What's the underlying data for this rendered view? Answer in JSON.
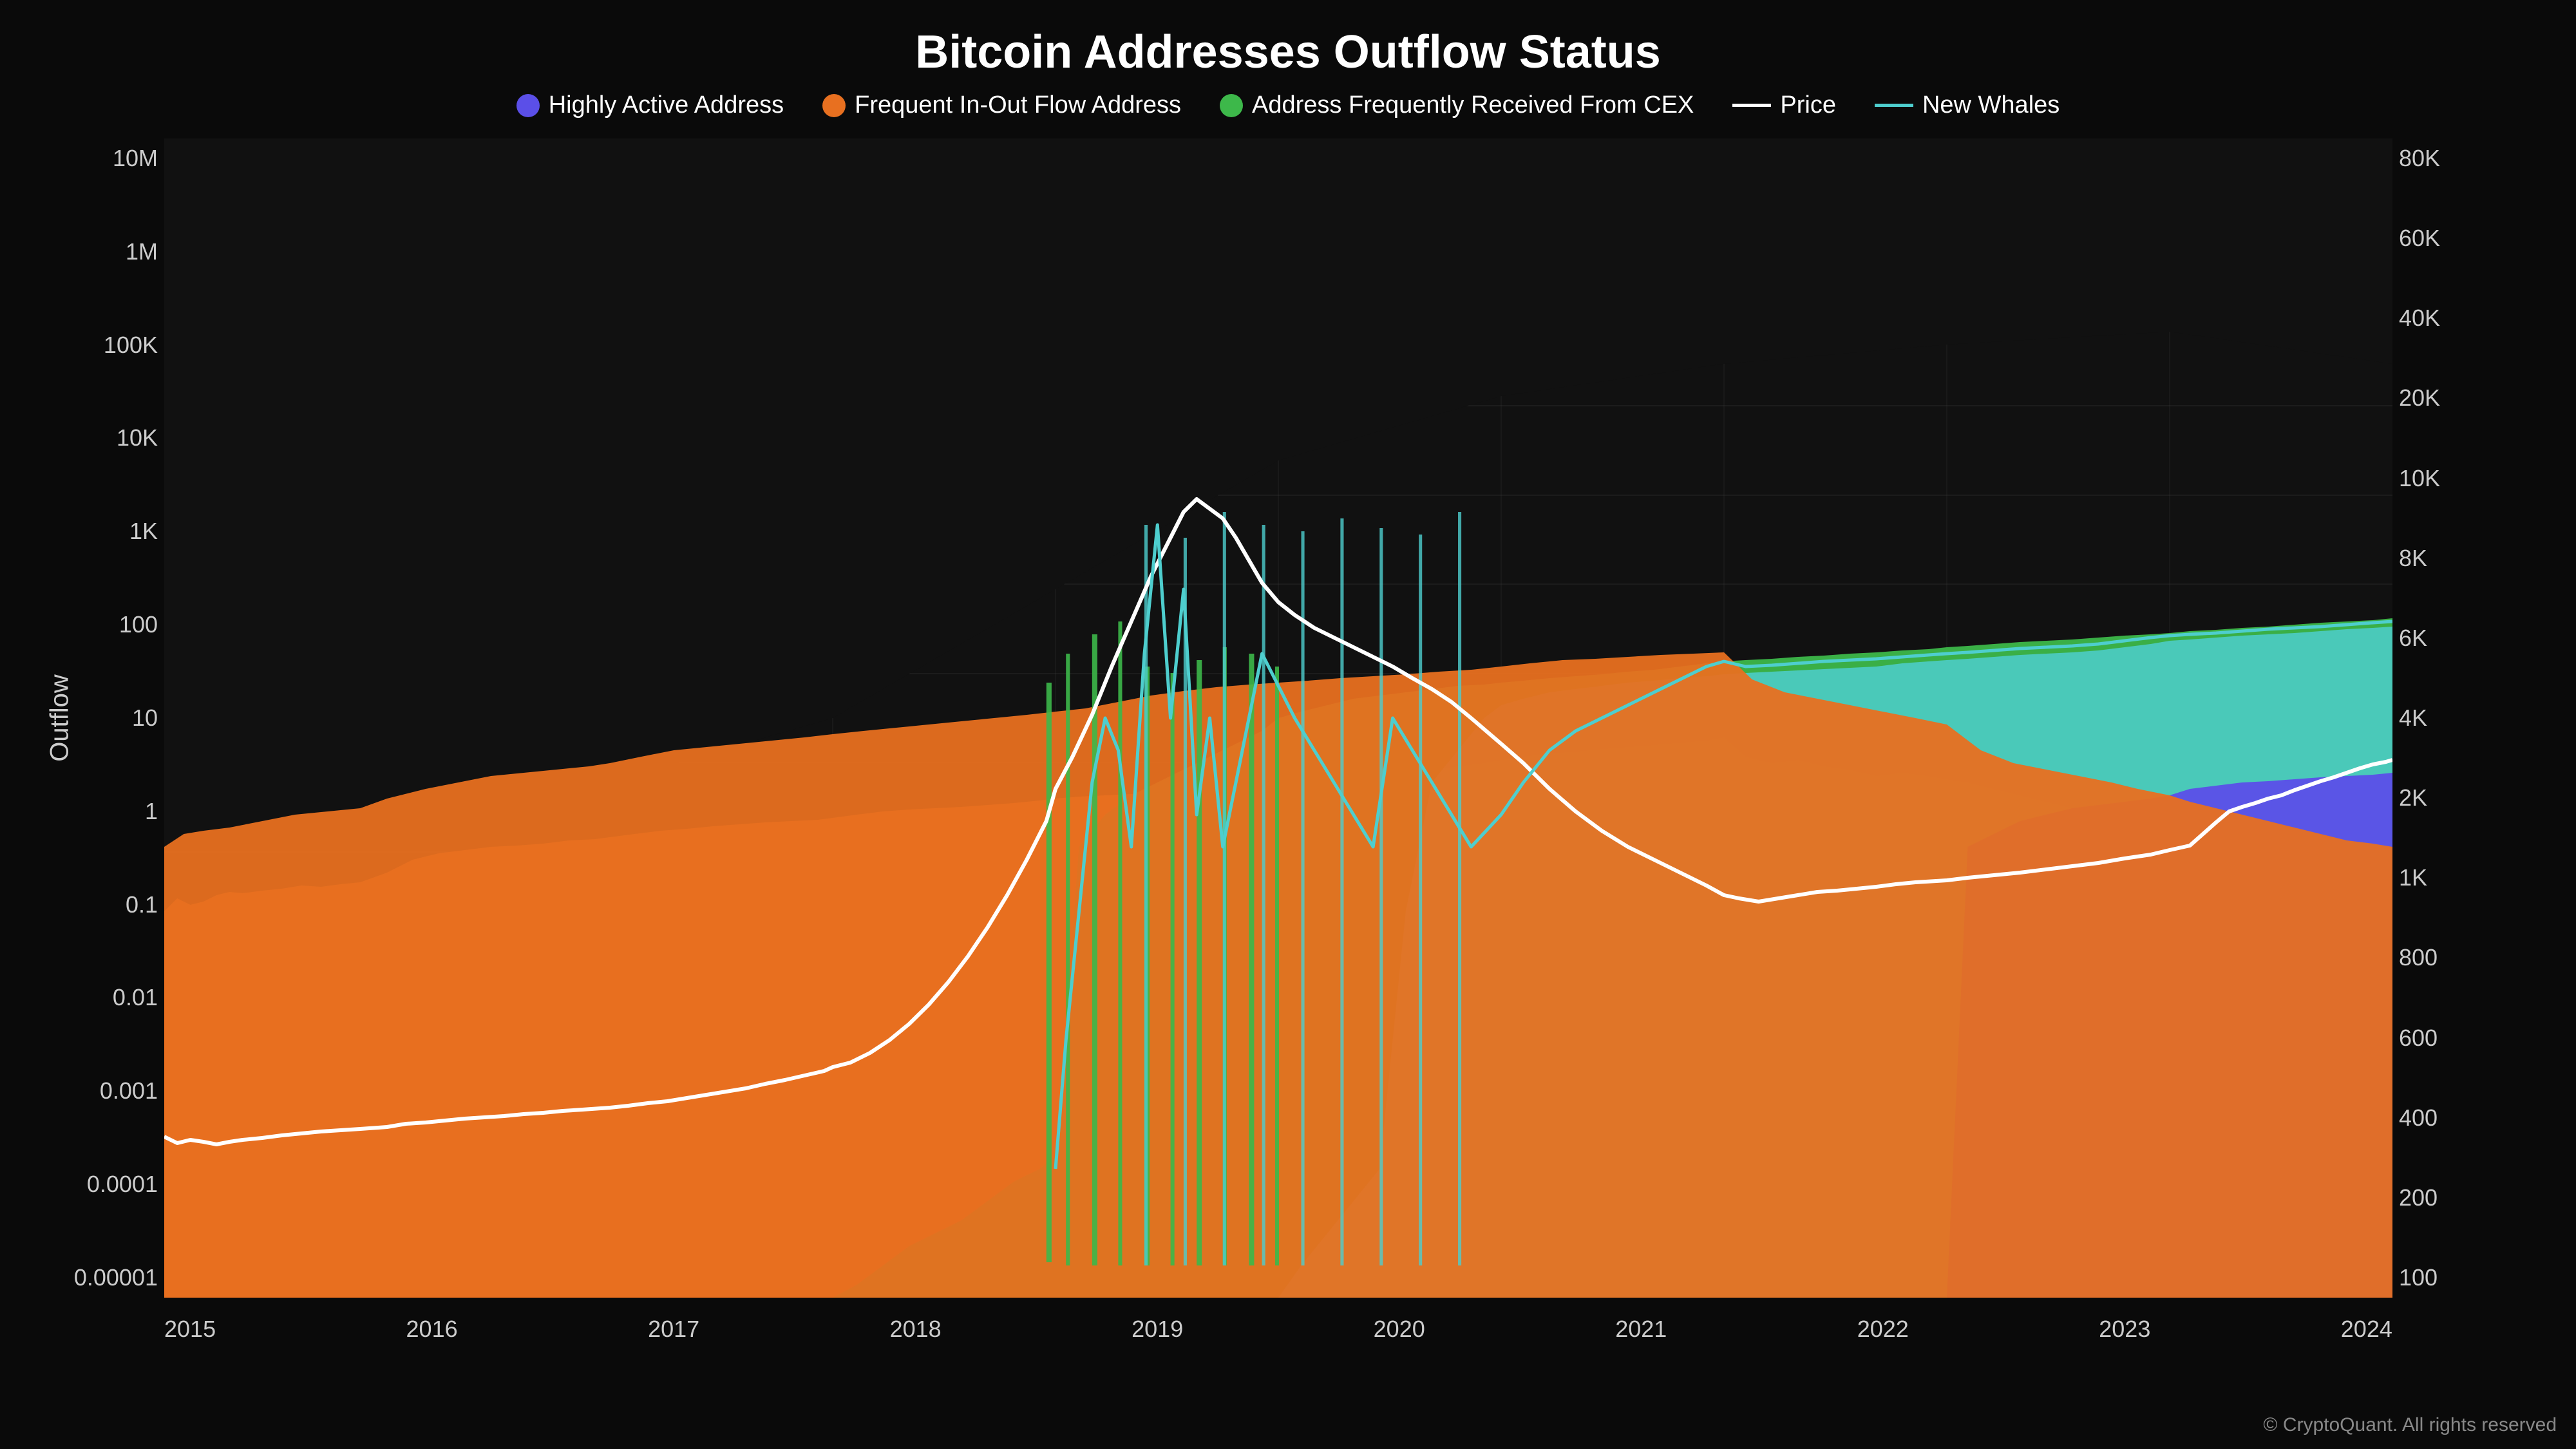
{
  "title": "Bitcoin Addresses Outflow Status",
  "legend": {
    "items": [
      {
        "label": "Highly Active Address",
        "type": "dot",
        "color": "#5B4FE8"
      },
      {
        "label": "Frequent In-Out Flow Address",
        "type": "dot",
        "color": "#E87020"
      },
      {
        "label": "Address Frequently Received From CEX",
        "type": "dot",
        "color": "#3DB84A"
      },
      {
        "label": "Price",
        "type": "line",
        "color": "#FFFFFF"
      },
      {
        "label": "New Whales",
        "type": "line",
        "color": "#4ECECE"
      }
    ]
  },
  "yAxisLeft": [
    "10M",
    "1M",
    "100K",
    "10K",
    "1K",
    "100",
    "10",
    "1",
    "0.1",
    "0.01",
    "0.001",
    "0.0001",
    "0.00001"
  ],
  "yAxisRight": [
    "80K",
    "60K",
    "40K",
    "20K",
    "10K",
    "8K",
    "6K",
    "4K",
    "2K",
    "1K",
    "800",
    "600",
    "400",
    "200",
    "100"
  ],
  "xAxis": [
    "2015",
    "2016",
    "2017",
    "2018",
    "2019",
    "2020",
    "2021",
    "2022",
    "2023",
    "2024"
  ],
  "yAxisTitle": "Outflow",
  "copyright": "© CryptoQuant. All rights reserved"
}
